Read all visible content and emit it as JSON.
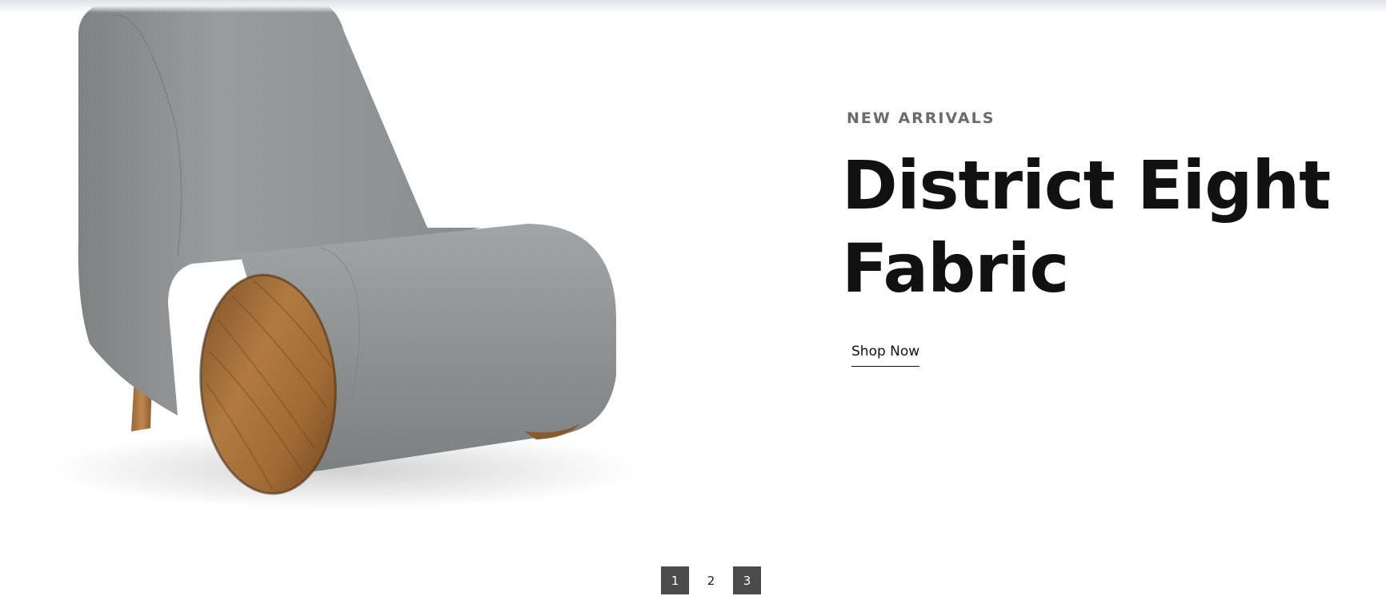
{
  "hero": {
    "eyebrow": "NEW ARRIVALS",
    "title_line1": "District Eight",
    "title_line2": "Fabric",
    "cta_label": "Shop Now",
    "image_icon": "lounge-chair-image"
  },
  "pagination": {
    "pages": [
      "1",
      "2",
      "3"
    ]
  },
  "colors": {
    "title": "#111111",
    "eyebrow": "#6b6b6b",
    "fabric": "#8e9192",
    "wood": "#a8713d",
    "pager_active": "#4b4b4b"
  }
}
